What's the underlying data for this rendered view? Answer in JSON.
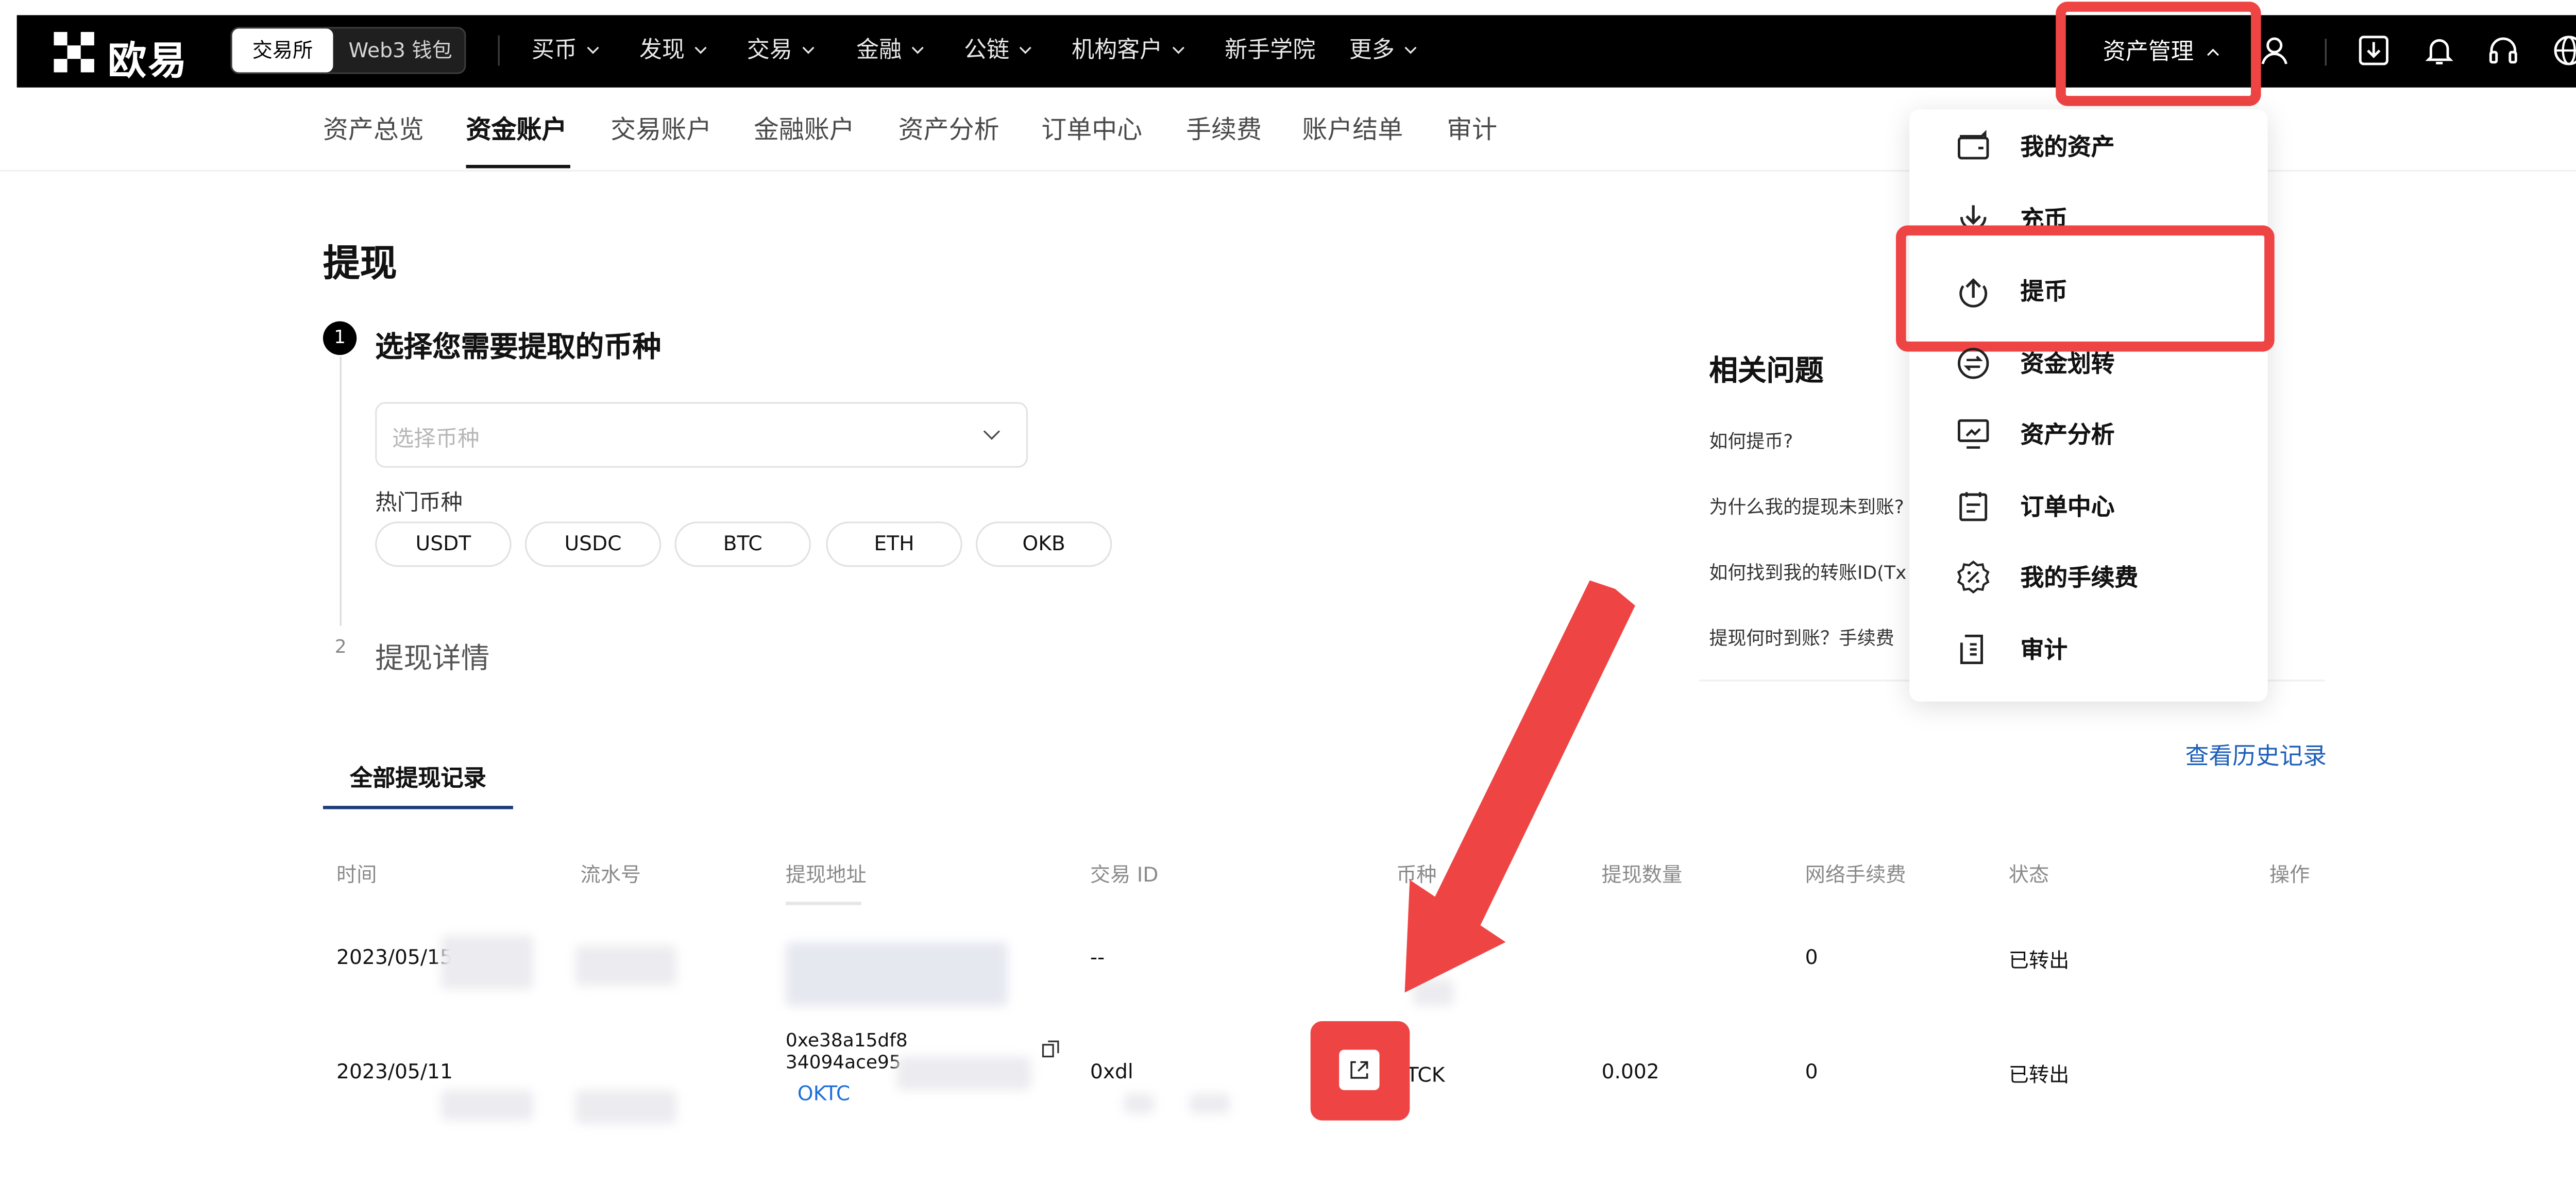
{
  "topbar": {
    "brand": "欧易",
    "tab_exchange": "交易所",
    "tab_web3": "Web3 钱包",
    "nav": [
      "买币",
      "发现",
      "交易",
      "金融",
      "公链",
      "机构客户",
      "新手学院",
      "更多"
    ],
    "asset_management": "资产管理",
    "icons": [
      "user-icon",
      "download-icon",
      "bell-icon",
      "headset-icon",
      "globe-icon"
    ]
  },
  "subnav": {
    "items": [
      "资产总览",
      "资金账户",
      "交易账户",
      "金融账户",
      "资产分析",
      "订单中心",
      "手续费",
      "账户结单",
      "审计"
    ],
    "active": "资金账户"
  },
  "page": {
    "title": "提现",
    "step1": {
      "number": "1",
      "title": "选择您需要提取的币种"
    },
    "select": {
      "placeholder": "选择币种"
    },
    "hot_label": "热门币种",
    "hot_coins": [
      "USDT",
      "USDC",
      "BTC",
      "ETH",
      "OKB"
    ],
    "step2": {
      "number": "2",
      "title": "提现详情"
    }
  },
  "faq": {
    "title": "相关问题",
    "items": [
      "如何提币?",
      "为什么我的提现未到账?",
      "如何找到我的转账ID(Tx",
      "提现何时到账？手续费"
    ]
  },
  "records": {
    "tab": "全部提现记录",
    "history_link": "查看历史记录",
    "columns": [
      "时间",
      "流水号",
      "提现地址",
      "交易 ID",
      "币种",
      "提现数量",
      "网络手续费",
      "状态",
      "操作"
    ],
    "rows": [
      {
        "time": "2023/05/15",
        "txid": "--",
        "fee": "0",
        "status": "已转出"
      },
      {
        "time": "2023/05/11",
        "address_line1": "0xe38a15df8",
        "address_line2": "34094ace95",
        "network": "OKTC",
        "txid": "0xdl",
        "coin": "TCK",
        "amount": "0.002",
        "fee": "0",
        "status": "已转出"
      }
    ]
  },
  "dropdown": {
    "items": [
      "我的资产",
      "充币",
      "提币",
      "资金划转",
      "资产分析",
      "订单中心",
      "我的手续费",
      "审计"
    ],
    "highlighted": "提币"
  },
  "colors": {
    "highlight": "#ef4444",
    "link": "#1e5fb8",
    "topbar": "#000000"
  }
}
